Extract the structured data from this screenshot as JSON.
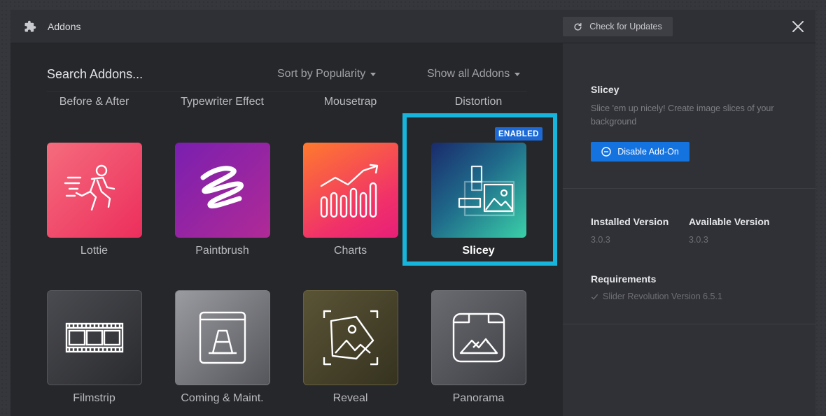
{
  "window": {
    "title": "Addons",
    "check_updates_label": "Check for Updates"
  },
  "filters": {
    "search_label": "Search Addons...",
    "sort_label": "Sort by Popularity",
    "show_label": "Show all Addons"
  },
  "top_row_labels": [
    "Before & After",
    "Typewriter Effect",
    "Mousetrap",
    "Distortion"
  ],
  "addons": [
    {
      "name": "Lottie",
      "icon": "running-man-icon"
    },
    {
      "name": "Paintbrush",
      "icon": "scribble-icon"
    },
    {
      "name": "Charts",
      "icon": "bar-chart-icon"
    },
    {
      "name": "Slicey",
      "icon": "image-slices-icon",
      "badge": "ENABLED",
      "selected": true
    },
    {
      "name": "Filmstrip",
      "icon": "filmstrip-icon"
    },
    {
      "name": "Coming & Maint.",
      "icon": "traffic-cone-icon"
    },
    {
      "name": "Reveal",
      "icon": "image-tag-icon"
    },
    {
      "name": "Panorama",
      "icon": "panorama-icon"
    }
  ],
  "details": {
    "title": "Slicey",
    "description": "Slice 'em up nicely! Create image slices of your background",
    "disable_label": "Disable Add-On",
    "installed_version_label": "Installed Version",
    "installed_version": "3.0.3",
    "available_version_label": "Available Version",
    "available_version": "3.0.3",
    "requirements_label": "Requirements",
    "requirement": "Slider Revolution Version 6.5.1"
  },
  "colors": {
    "selection": "#17b4db",
    "primary_button": "#1573e0",
    "badge": "#1d6ad6"
  }
}
